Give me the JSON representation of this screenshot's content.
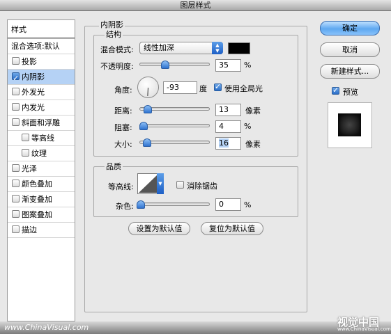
{
  "window": {
    "title": "图层样式"
  },
  "styles_panel": {
    "header": "样式",
    "blend_options": "混合选项:默认",
    "items": [
      {
        "label": "投影",
        "checked": false
      },
      {
        "label": "内阴影",
        "checked": true,
        "selected": true
      },
      {
        "label": "外发光",
        "checked": false
      },
      {
        "label": "内发光",
        "checked": false
      },
      {
        "label": "斜面和浮雕",
        "checked": false
      },
      {
        "label": "等高线",
        "checked": false,
        "sub": true
      },
      {
        "label": "纹理",
        "checked": false,
        "sub": true
      },
      {
        "label": "光泽",
        "checked": false
      },
      {
        "label": "颜色叠加",
        "checked": false
      },
      {
        "label": "渐变叠加",
        "checked": false
      },
      {
        "label": "图案叠加",
        "checked": false
      },
      {
        "label": "描边",
        "checked": false
      }
    ]
  },
  "inner_shadow": {
    "title": "内阴影",
    "structure": {
      "title": "结构",
      "blend_mode_label": "混合模式:",
      "blend_mode_value": "线性加深",
      "shadow_color": "#000000",
      "opacity_label": "不透明度:",
      "opacity_value": "35",
      "opacity_unit": "%",
      "angle_label": "角度:",
      "angle_value": "-93",
      "angle_unit": "度",
      "global_light_label": "使用全局光",
      "global_light_checked": true,
      "distance_label": "距离:",
      "distance_value": "13",
      "distance_unit": "像素",
      "choke_label": "阻塞:",
      "choke_value": "4",
      "choke_unit": "%",
      "size_label": "大小:",
      "size_value": "16",
      "size_unit": "像素"
    },
    "quality": {
      "title": "品质",
      "contour_label": "等高线:",
      "anti_alias_label": "消除锯齿",
      "anti_alias_checked": false,
      "noise_label": "杂色:",
      "noise_value": "0",
      "noise_unit": "%"
    },
    "make_default": "设置为默认值",
    "reset_default": "复位为默认值"
  },
  "buttons": {
    "ok": "确定",
    "cancel": "取消",
    "new_style": "新建样式...",
    "preview_label": "预览",
    "preview_checked": true
  },
  "watermark": {
    "left": "www.ChinaVisual.com",
    "right": "视觉中国",
    "right_url": "www.ChinaVisual.com"
  },
  "colors": {
    "accent": "#3b82e0",
    "selection": "#b5d2f5"
  }
}
